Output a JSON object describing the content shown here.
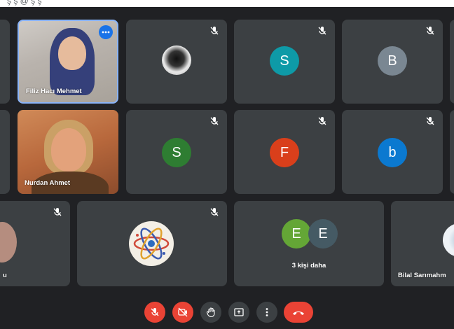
{
  "top_text": "ş ş @ ş ş",
  "participants": {
    "tile_1": {
      "name": "Filiz Hacı Mehmet"
    },
    "tile_5": {
      "name": "Nurdan Ahmet"
    },
    "tile_3": {
      "initial": "S",
      "color": "#0e9aa7"
    },
    "tile_4": {
      "initial": "B",
      "color": "#7a8792"
    },
    "tile_6": {
      "initial": "S",
      "color": "#2e7d32"
    },
    "tile_7": {
      "initial": "F",
      "color": "#d93f1b"
    },
    "tile_8": {
      "initial": "b",
      "color": "#0b79d0"
    },
    "tile_9": {
      "name": "u"
    },
    "tile_11": {
      "others_label": "3 kişi daha",
      "initial_a": "E",
      "initial_b": "E",
      "color_a": "#64a636",
      "color_b": "#455a64"
    },
    "tile_12": {
      "name": "Bilal Sarımahm"
    }
  },
  "controls": {
    "mic": {
      "icon": "mic-off-icon"
    },
    "camera": {
      "icon": "camera-off-icon"
    },
    "hand": {
      "icon": "raise-hand-icon"
    },
    "present": {
      "icon": "present-screen-icon"
    },
    "more": {
      "icon": "more-options-icon"
    },
    "hangup": {
      "icon": "hang-up-icon"
    }
  }
}
